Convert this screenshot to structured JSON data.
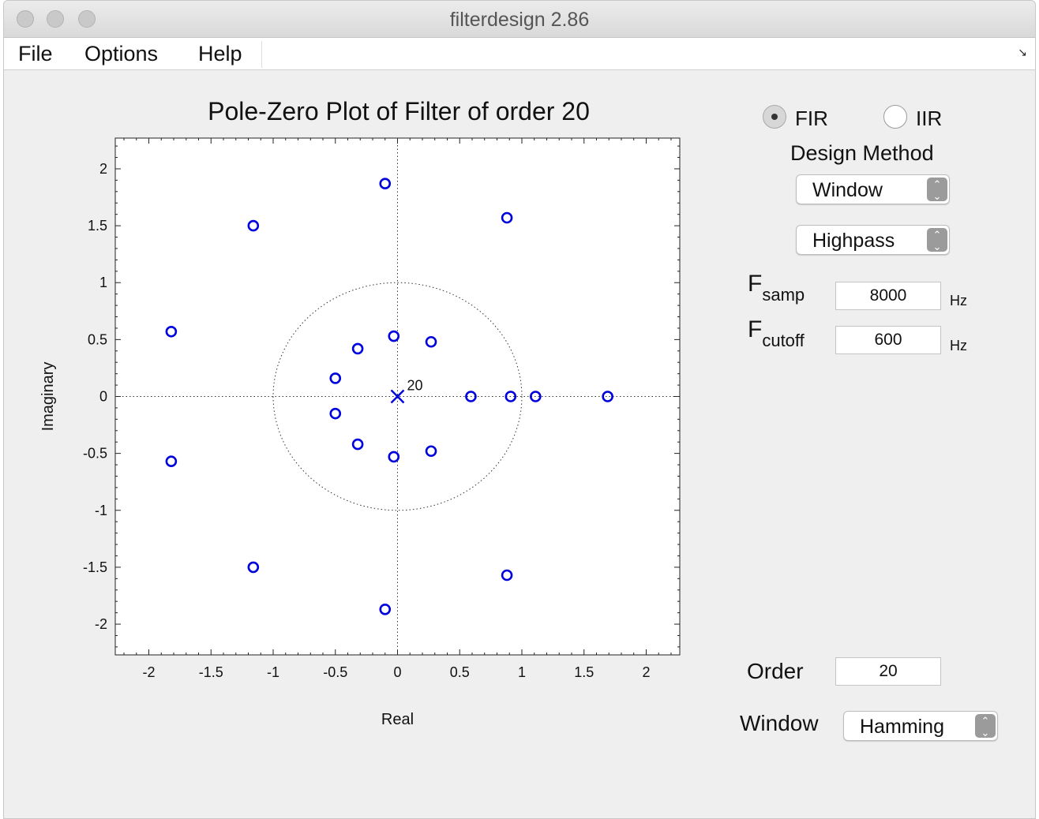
{
  "window": {
    "title": "filterdesign 2.86"
  },
  "menu": {
    "items": [
      "File",
      "Options",
      "Help"
    ],
    "resize_icon": "resize-arrow-icon"
  },
  "filter_type": {
    "fir_label": "FIR",
    "iir_label": "IIR",
    "selected": "FIR"
  },
  "design_method": {
    "label": "Design Method",
    "method_value": "Window",
    "type_value": "Highpass"
  },
  "params": {
    "fsamp_main": "F",
    "fsamp_sub": "samp",
    "fsamp_value": "8000",
    "fsamp_unit": "Hz",
    "fcutoff_main": "F",
    "fcutoff_sub": "cutoff",
    "fcutoff_value": "600",
    "fcutoff_unit": "Hz"
  },
  "order": {
    "label": "Order",
    "value": "20"
  },
  "window_select": {
    "label": "Window",
    "value": "Hamming"
  },
  "colors": {
    "marker": "#0000dd",
    "panel": "#efefef"
  },
  "chart_data": {
    "type": "scatter",
    "title": "Pole-Zero Plot of Filter of order 20",
    "xlabel": "Real",
    "ylabel": "Imaginary",
    "xlim": [
      -2.27,
      2.27
    ],
    "ylim": [
      -2.27,
      2.27
    ],
    "xticks": [
      -2,
      -1.5,
      -1,
      -0.5,
      0,
      0.5,
      1,
      1.5,
      2
    ],
    "yticks": [
      -2,
      -1.5,
      -1,
      -0.5,
      0,
      0.5,
      1,
      1.5,
      2
    ],
    "tick_labels": [
      "-2",
      "-1.5",
      "-1",
      "-0.5",
      "0",
      "0.5",
      "1",
      "1.5",
      "2"
    ],
    "unit_circle": true,
    "axes_dotted_lines": true,
    "zeros": [
      {
        "x": -0.1,
        "y": 1.87
      },
      {
        "x": -0.1,
        "y": -1.87
      },
      {
        "x": 0.88,
        "y": 1.57
      },
      {
        "x": 0.88,
        "y": -1.57
      },
      {
        "x": -1.16,
        "y": 1.5
      },
      {
        "x": -1.16,
        "y": -1.5
      },
      {
        "x": -1.82,
        "y": 0.57
      },
      {
        "x": -1.82,
        "y": -0.57
      },
      {
        "x": -0.03,
        "y": 0.53
      },
      {
        "x": -0.03,
        "y": -0.53
      },
      {
        "x": 0.27,
        "y": 0.48
      },
      {
        "x": 0.27,
        "y": -0.48
      },
      {
        "x": -0.32,
        "y": 0.42
      },
      {
        "x": -0.32,
        "y": -0.42
      },
      {
        "x": -0.5,
        "y": 0.16
      },
      {
        "x": -0.5,
        "y": -0.15
      },
      {
        "x": 0.59,
        "y": 0.0
      },
      {
        "x": 0.91,
        "y": 0.0
      },
      {
        "x": 1.11,
        "y": 0.0
      },
      {
        "x": 1.69,
        "y": 0.0
      }
    ],
    "poles": [
      {
        "x": 0,
        "y": 0,
        "multiplicity": "20"
      }
    ]
  }
}
